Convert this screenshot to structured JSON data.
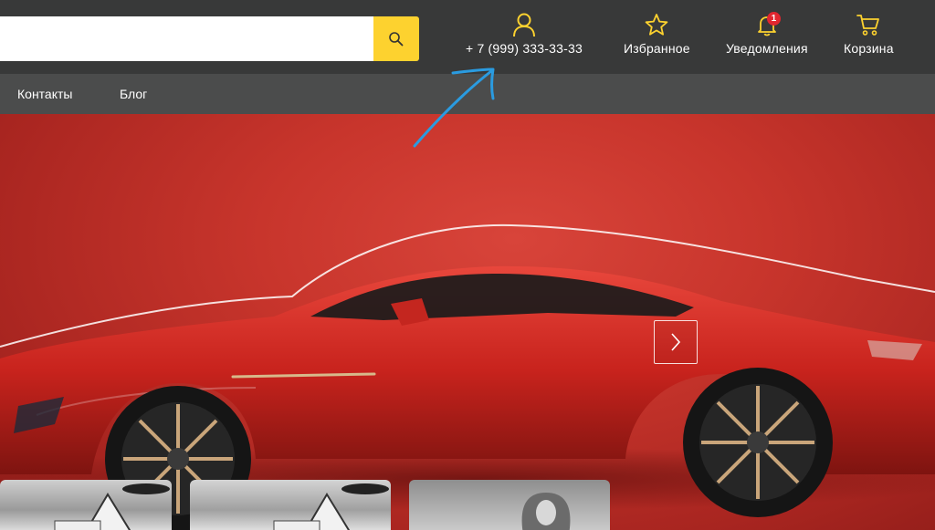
{
  "header": {
    "search": {
      "value": "",
      "placeholder": ""
    },
    "contact": {
      "icon": "user-icon",
      "phone": "+ 7 (999) 333-33-33"
    },
    "favorites": {
      "icon": "star-icon",
      "label": "Избранное"
    },
    "notifications": {
      "icon": "bell-icon",
      "label": "Уведомления",
      "count": "1"
    },
    "cart": {
      "icon": "cart-icon",
      "label": "Корзина"
    }
  },
  "nav": {
    "items": [
      {
        "label": "Контакты"
      },
      {
        "label": "Блог"
      }
    ]
  },
  "hero": {
    "image": "red-sports-car",
    "next_icon": "chevron-right-icon"
  },
  "thumbnails": [
    {
      "image": "warning-sign-photo"
    },
    {
      "image": "warning-sign-photo"
    },
    {
      "image": "portrait-photo"
    }
  ],
  "colors": {
    "topbar": "#383939",
    "navbar": "#4b4c4c",
    "accent_yellow": "#fdd22f",
    "badge_red": "#e1262f",
    "annotation_blue": "#2a9be0"
  }
}
